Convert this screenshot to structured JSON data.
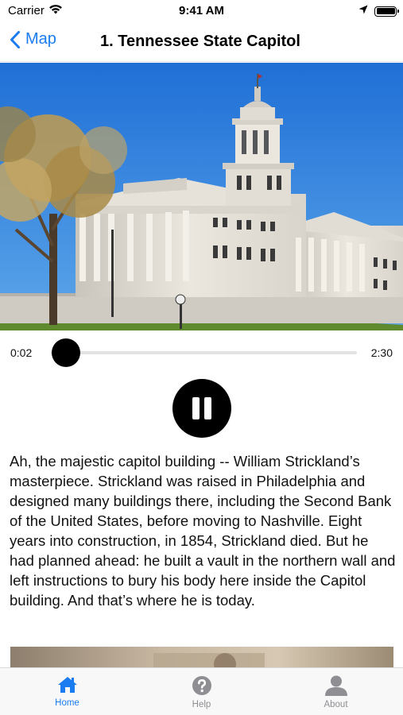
{
  "status_bar": {
    "carrier": "Carrier",
    "time": "9:41 AM",
    "wifi_icon": "wifi-icon",
    "location_icon": "location-arrow-icon",
    "battery_icon": "battery-icon"
  },
  "nav": {
    "back_label": "Map",
    "back_icon": "chevron-left-icon",
    "title": "1. Tennessee State Capitol"
  },
  "hero": {
    "subject": "Tennessee State Capitol"
  },
  "player": {
    "current_time": "0:02",
    "total_time": "2:30",
    "progress": 0.013,
    "state": "playing",
    "pause_icon": "pause-icon"
  },
  "description": "Ah, the majestic capitol building -- William Strickland’s masterpiece. Strickland was raised in Philadelphia and designed many buildings there, including the Second Bank of the United States, before moving to Nashville. Eight years into construction, in 1854, Strickland died. But he had planned ahead: he built a vault in the northern wall and left instructions to bury his body here inside the Capitol building. And that’s where he is today.",
  "tabs": [
    {
      "label": "Home",
      "icon": "home-icon",
      "active": true
    },
    {
      "label": "Help",
      "icon": "help-icon",
      "active": false
    },
    {
      "label": "About",
      "icon": "person-icon",
      "active": false
    }
  ],
  "colors": {
    "accent": "#1a7cf0",
    "inactive": "#8e8e93"
  }
}
